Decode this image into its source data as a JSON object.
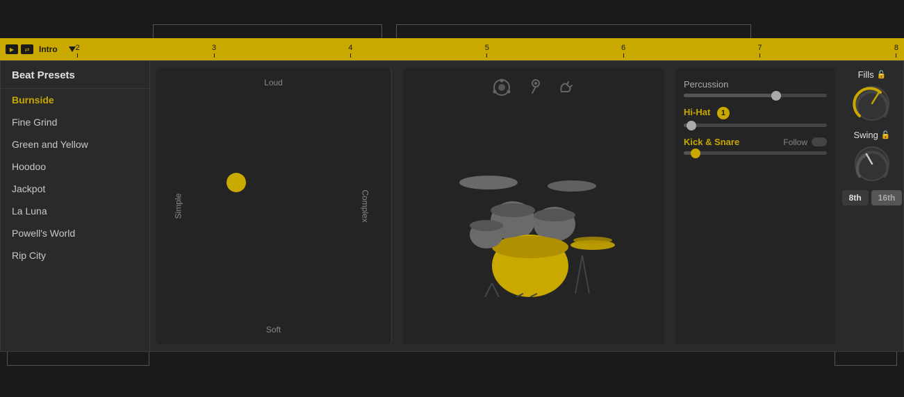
{
  "timeline": {
    "label": "Intro",
    "markers": [
      "2",
      "3",
      "4",
      "5",
      "6",
      "7",
      "8"
    ]
  },
  "sidebar": {
    "header": "Beat Presets",
    "items": [
      {
        "label": "Burnside",
        "active": true
      },
      {
        "label": "Fine Grind",
        "active": false
      },
      {
        "label": "Green and Yellow",
        "active": false
      },
      {
        "label": "Hoodoo",
        "active": false
      },
      {
        "label": "Jackpot",
        "active": false
      },
      {
        "label": "La Luna",
        "active": false
      },
      {
        "label": "Powell's World",
        "active": false
      },
      {
        "label": "Rip City",
        "active": false
      }
    ]
  },
  "beat_pad": {
    "top_label": "Loud",
    "bottom_label": "Soft",
    "left_label": "Simple",
    "right_label": "Complex"
  },
  "drum_controls": {
    "percussion_label": "Percussion",
    "hihat_label": "Hi-Hat",
    "hihat_badge": "1",
    "kick_snare_label": "Kick & Snare",
    "follow_label": "Follow"
  },
  "fills": {
    "label": "Fills",
    "knob_value": 75
  },
  "swing": {
    "label": "Swing",
    "knob_value": 30,
    "buttons": [
      {
        "label": "8th",
        "active": true
      },
      {
        "label": "16th",
        "active": false
      }
    ]
  }
}
